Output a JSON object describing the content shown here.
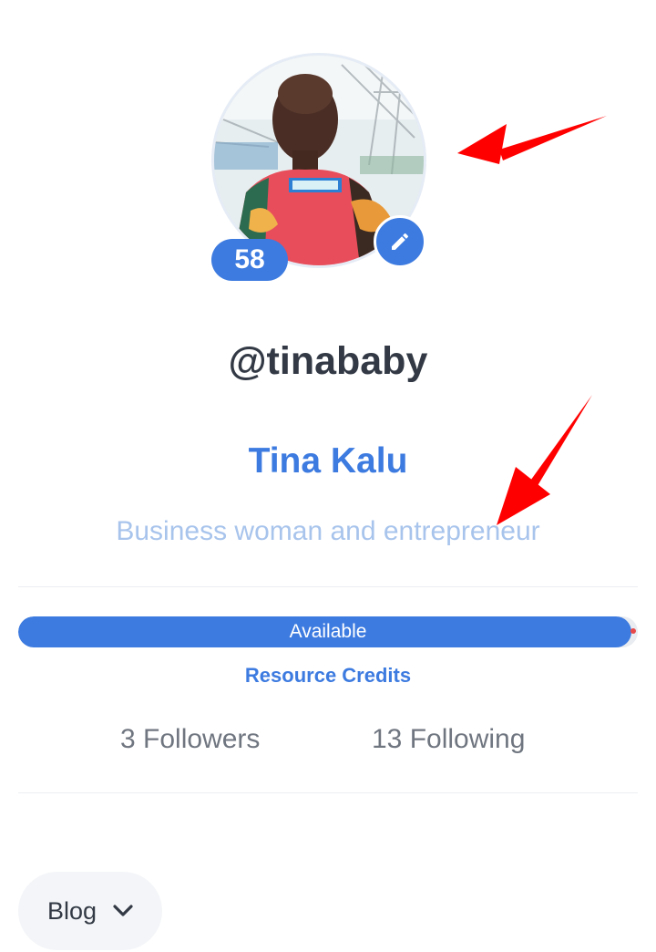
{
  "profile": {
    "reputation": "58",
    "username": "@tinababy",
    "display_name": "Tina Kalu",
    "bio": "Business woman and entrepreneur"
  },
  "resource_credits": {
    "status_label": "Available",
    "percent": 99,
    "link_label": "Resource Credits"
  },
  "stats": {
    "followers": "3 Followers",
    "following": "13 Following"
  },
  "menu": {
    "selected": "Blog"
  },
  "icons": {
    "edit": "pencil-icon",
    "dropdown": "chevron-down-icon"
  },
  "colors": {
    "accent": "#3d7be0",
    "bio_text": "#a8c4ec",
    "annotation": "#ff0000"
  }
}
